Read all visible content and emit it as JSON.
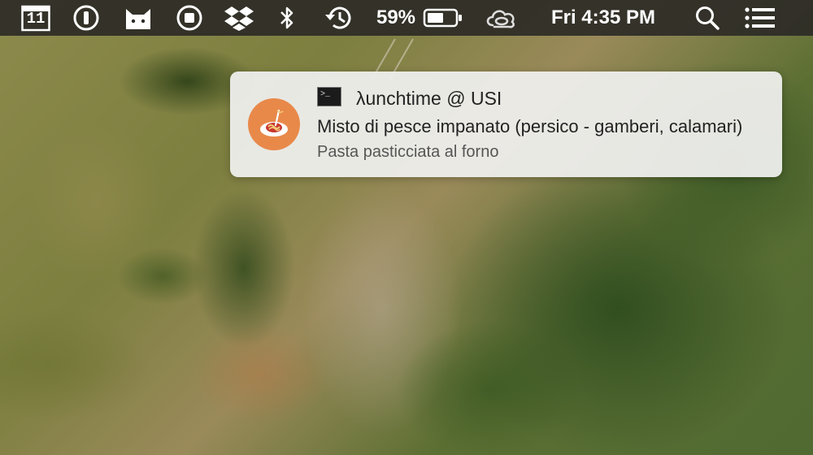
{
  "menubar": {
    "calendar_day": "11",
    "battery_percent": "59%",
    "clock": "Fri 4:35 PM",
    "icons": [
      "calendar-icon",
      "1password-icon",
      "cat-icon",
      "record-icon",
      "dropbox-icon",
      "bluetooth-icon",
      "time-machine-icon",
      "battery-icon",
      "creative-cloud-icon",
      "spotlight-search-icon",
      "notification-center-icon"
    ]
  },
  "notification": {
    "app_icon": "terminal-icon",
    "avatar_icon": "spaghetti-icon",
    "title": "λunchtime @ USI",
    "line1": "Misto di pesce impanato (persico - gamberi, calamari)",
    "line2": "Pasta pasticciata al forno",
    "colors": {
      "avatar": "#e8894a"
    }
  }
}
